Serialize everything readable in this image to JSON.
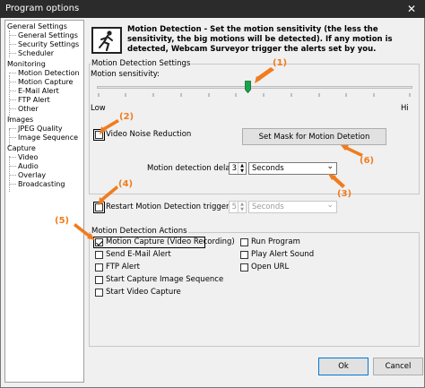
{
  "window": {
    "title": "Program options",
    "close_glyph": "✕"
  },
  "tree": {
    "items": [
      {
        "label": "General Settings",
        "level": 0
      },
      {
        "label": "General Settings",
        "level": 1
      },
      {
        "label": "Security Settings",
        "level": 1
      },
      {
        "label": "Scheduler",
        "level": 1
      },
      {
        "label": "Monitoring",
        "level": 0
      },
      {
        "label": "Motion Detection",
        "level": 1
      },
      {
        "label": "Motion Capture",
        "level": 1
      },
      {
        "label": "E-Mail Alert",
        "level": 1
      },
      {
        "label": "FTP Alert",
        "level": 1
      },
      {
        "label": "Other",
        "level": 1
      },
      {
        "label": "Images",
        "level": 0
      },
      {
        "label": "JPEG Quality",
        "level": 1
      },
      {
        "label": "Image Sequence",
        "level": 1
      },
      {
        "label": "Capture",
        "level": 0
      },
      {
        "label": "Video",
        "level": 1
      },
      {
        "label": "Audio",
        "level": 1
      },
      {
        "label": "Overlay",
        "level": 1
      },
      {
        "label": "Broadcasting",
        "level": 1
      }
    ]
  },
  "header": {
    "icon": "running-man-icon",
    "text": "Motion Detection - Set the motion sensitivity (the less the sensitivity, the big motions will be detected). If any motion is detected, Webcam Surveyor trigger the alerts set by you."
  },
  "settings": {
    "group_label": "Motion Detection Settings",
    "sensitivity_label": "Motion sensitivity:",
    "slider_value": 0.5,
    "low_label": "Low",
    "hi_label": "Hi",
    "noise_reduction_label": "Video Noise Reduction",
    "noise_reduction_checked": false,
    "set_mask_button": "Set Mask for Motion Detetion",
    "delay_label": "Motion detection delay:",
    "delay_value": "3",
    "delay_unit": "Seconds",
    "restart_label": "Restart Motion Detection trigger",
    "restart_checked": false,
    "restart_value": "5",
    "restart_unit": "Seconds"
  },
  "actions": {
    "group_label": "Motion Detection Actions",
    "left": [
      {
        "label": "Motion Capture (Video Recording)",
        "checked": true
      },
      {
        "label": "Send E-Mail  Alert",
        "checked": false
      },
      {
        "label": "FTP Alert",
        "checked": false
      },
      {
        "label": "Start Capture Image Sequence",
        "checked": false
      },
      {
        "label": "Start Video Capture",
        "checked": false
      }
    ],
    "right": [
      {
        "label": "Run Program",
        "checked": false
      },
      {
        "label": "Play Alert Sound",
        "checked": false
      },
      {
        "label": "Open URL",
        "checked": false
      }
    ]
  },
  "buttons": {
    "ok": "Ok",
    "cancel": "Cancel"
  },
  "callouts": [
    "(1)",
    "(2)",
    "(3)",
    "(4)",
    "(5)",
    "(6)"
  ],
  "colors": {
    "callout": "#f07c1e",
    "titlebar": "#2b2b2b",
    "thumb": "#1aa34a"
  }
}
